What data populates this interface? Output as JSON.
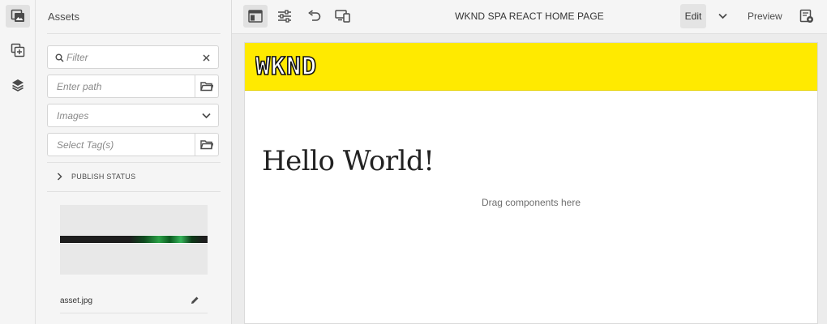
{
  "sidebar_rail": {
    "items": [
      {
        "icon": "assets-icon",
        "active": true
      },
      {
        "icon": "components-icon",
        "active": false
      },
      {
        "icon": "content-tree-icon",
        "active": false
      }
    ]
  },
  "assets_panel": {
    "title": "Assets",
    "filter_placeholder": "Filter",
    "path_placeholder": "Enter path",
    "type_select": "Images",
    "tags_placeholder": "Select Tag(s)",
    "publish_status_label": "PUBLISH STATUS",
    "asset": {
      "name": "asset.jpg"
    }
  },
  "toolbar": {
    "page_title": "WKND SPA REACT HOME PAGE",
    "edit_label": "Edit",
    "preview_label": "Preview"
  },
  "page": {
    "logo_text": "WKND",
    "heading": "Hello World!",
    "drop_zone_text": "Drag components here"
  },
  "colors": {
    "header_yellow": "#ffea00",
    "panel_bg": "#f5f5f5"
  }
}
